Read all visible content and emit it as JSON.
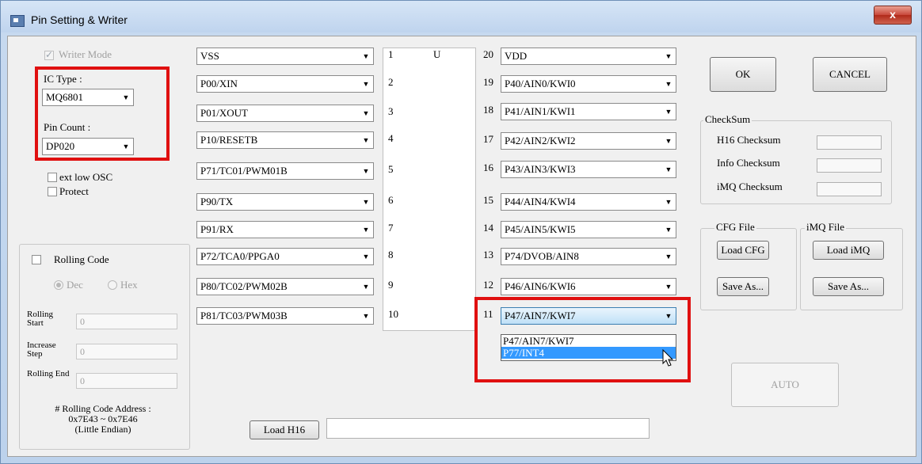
{
  "window": {
    "title": "Pin Setting & Writer",
    "close_label": "x"
  },
  "left": {
    "writer_mode": "Writer Mode",
    "ic_type_label": "IC Type :",
    "ic_type_value": "MQ6801",
    "pin_count_label": "Pin Count :",
    "pin_count_value": "DP020",
    "ext_low_osc": "ext low OSC",
    "protect": "Protect"
  },
  "rolling": {
    "title": "Rolling Code",
    "dec": "Dec",
    "hex": "Hex",
    "start_label": "Rolling Start",
    "start_value": "0",
    "step_label": "Increase Step",
    "step_value": "0",
    "end_label": "Rolling End",
    "end_value": "0",
    "address_line1": "# Rolling Code Address :",
    "address_line2": "0x7E43 ~ 0x7E46",
    "address_line3": "(Little Endian)"
  },
  "chip_marker": "U",
  "left_pins": [
    {
      "num": "1",
      "value": "VSS"
    },
    {
      "num": "2",
      "value": "P00/XIN"
    },
    {
      "num": "3",
      "value": "P01/XOUT"
    },
    {
      "num": "4",
      "value": "P10/RESETB"
    },
    {
      "num": "5",
      "value": "P71/TC01/PWM01B"
    },
    {
      "num": "6",
      "value": "P90/TX"
    },
    {
      "num": "7",
      "value": "P91/RX"
    },
    {
      "num": "8",
      "value": "P72/TCA0/PPGA0"
    },
    {
      "num": "9",
      "value": "P80/TC02/PWM02B"
    },
    {
      "num": "10",
      "value": "P81/TC03/PWM03B"
    }
  ],
  "right_pins": [
    {
      "num": "20",
      "value": "VDD"
    },
    {
      "num": "19",
      "value": "P40/AIN0/KWI0"
    },
    {
      "num": "18",
      "value": "P41/AIN1/KWI1"
    },
    {
      "num": "17",
      "value": "P42/AIN2/KWI2"
    },
    {
      "num": "16",
      "value": "P43/AIN3/KWI3"
    },
    {
      "num": "15",
      "value": "P44/AIN4/KWI4"
    },
    {
      "num": "14",
      "value": "P45/AIN5/KWI5"
    },
    {
      "num": "13",
      "value": "P74/DVOB/AIN8"
    },
    {
      "num": "12",
      "value": "P46/AIN6/KWI6"
    },
    {
      "num": "11",
      "value": "P47/AIN7/KWI7"
    }
  ],
  "pin11_options": [
    "P47/AIN7/KWI7",
    "P77/INT4"
  ],
  "buttons": {
    "ok": "OK",
    "cancel": "CANCEL",
    "auto": "AUTO",
    "load_h16": "Load H16"
  },
  "checksum": {
    "title": "CheckSum",
    "h16": "H16 Checksum",
    "info": "Info Checksum",
    "imq": "iMQ Checksum"
  },
  "cfg": {
    "title": "CFG File",
    "load": "Load CFG",
    "save": "Save As..."
  },
  "imq": {
    "title": "iMQ File",
    "load": "Load iMQ",
    "save": "Save As..."
  },
  "colors": {
    "highlight": "#e01010",
    "selection": "#3399ff"
  }
}
